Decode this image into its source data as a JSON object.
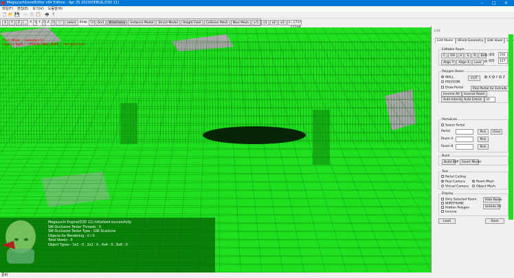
{
  "window": {
    "title": "MegayuchiLevelEditor x64 Edition - Apr 25 2020(DEBUG,D3D 11)",
    "minimize": "–",
    "maximize": "□",
    "close": "✕"
  },
  "menu": [
    "파일(F)",
    "편집(E)",
    "보기(V)",
    "도움말(H)"
  ],
  "toolbar1": [
    "new-file-icon",
    "open-folder-icon",
    "save-icon",
    "cut-icon",
    "copy-icon",
    "paste-icon",
    "print-icon",
    "help-icon"
  ],
  "toolbar1_glyphs": [
    "🗋",
    "📂",
    "💾",
    "✂",
    "⎘",
    "📋",
    "🖶",
    "?"
  ],
  "toolbar2": {
    "axis_buttons": [
      "X",
      "Y",
      "Z",
      "_"
    ],
    "x_label": "X",
    "x_value": "0",
    "y_label": "Y",
    "y_value": "0",
    "z_label": "Z",
    "z_value": "0",
    "ok": "OK",
    "select": "select",
    "snap_label": "Snap",
    "snap_value": "50",
    "buttons": [
      "Grid",
      "WireFrame",
      "Instance Model",
      "Struct Model",
      "Height Field",
      "Collision Mesh",
      "Navi Mesh"
    ],
    "scale_buttons": [
      "x.5",
      "x1",
      "x2",
      "x3"
    ],
    "coords": "X=1737 , Y:1168 , Z:908"
  },
  "hud": {
    "line1": "Tool Mode : Unknown(?)",
    "line2": "Camera Mode : CAMERA_MODE_USER , Perspective"
  },
  "log": [
    "Megayuchi Engine(D3D 11) Initialized successfully.",
    "SW-Occlusion Tester Threads : 0",
    "SW-Occlusion Tester Type : SSE-ScanLine",
    "Objects for Rendering : 0 / 0",
    "Total Voxels : 0",
    "Object Types - 1x1 : 0 , 2x2 : 0 , 4x4 : 0 , 8x8 : 0"
  ],
  "status": "준비",
  "panel": {
    "title": "Edit",
    "tabs": [
      "Edit Model",
      "HField Geometry",
      "Edit Voxel",
      "Layer"
    ],
    "editable_room": {
      "legend": "Editable Room",
      "buttons": [
        "C",
        "OH",
        "H",
        "S",
        "R",
        "BL"
      ],
      "align_buttons": [
        "Align Y",
        "Align X",
        "Lock"
      ],
      "inner_label": "내력",
      "inner_value": "192",
      "outer_label": "외력",
      "outer_value": "127"
    },
    "polygon_room": {
      "legend": "Polygon Room",
      "wall": "WALL",
      "polygon": "POLYGON",
      "cut": "CUT",
      "axes": [
        "X",
        "Y",
        "Z"
      ],
      "draw_portal": "Draw Portal",
      "pick_portal": "Pick Portal for Extrude",
      "inverse_all": "Inverse All",
      "inverse_room": "Inverse Room",
      "auto_interior": "Auto Interior",
      "auto_exterior": "Auto Extrior",
      "extrude_value": "30"
    },
    "portal_link": {
      "legend": "PortalLink",
      "select_portal": "Select Portal",
      "portal": "Portal",
      "room_a": "Room A",
      "room_b": "Room B",
      "pick": "Pick",
      "clear": "Clear"
    },
    "build": {
      "legend": "Build",
      "build_bsp": "Build BSP",
      "insert_model": "Insert Model"
    },
    "test": {
      "legend": "Test",
      "portal_culling": "Portal Culling",
      "real_camera": "Real Camera",
      "virtual_camera": "Virtual Camera",
      "room_mesh": "Room Mesh",
      "object_mesh": "Object Mesh"
    },
    "display": {
      "legend": "Display",
      "only_selected": "Only Selected Room",
      "wireframe": "WIREFRAME",
      "hidden_polygon": "Hidden Polygon",
      "inverse": "Inverse",
      "hide_room": "Hide Room",
      "unhide_all": "Unhide All"
    },
    "load": "Load",
    "save": "Save"
  },
  "colors": {
    "viewport_green": "#1ee01e",
    "titlebar": "#0078d7",
    "hud_red": "#e00000"
  }
}
